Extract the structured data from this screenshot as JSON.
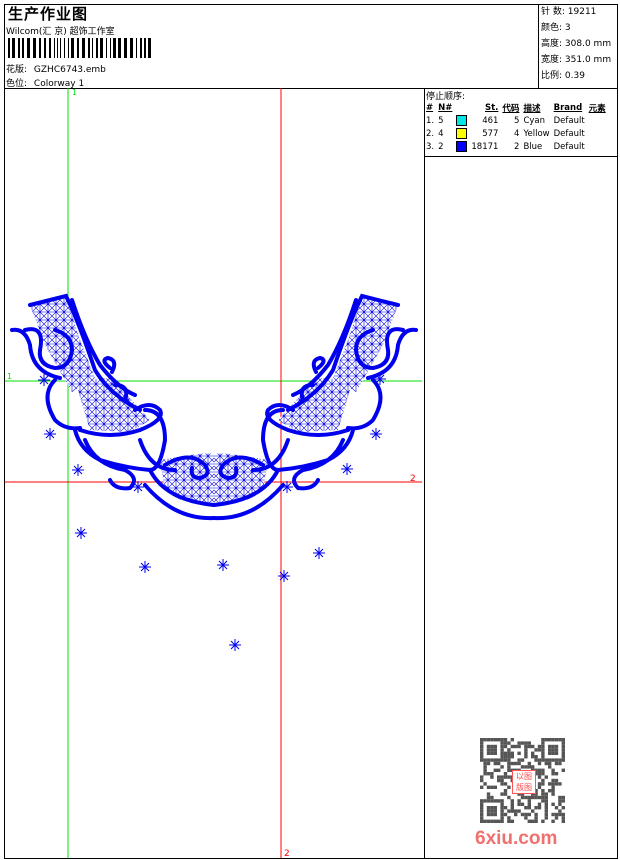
{
  "header": {
    "title": "生产作业图",
    "company": "Wilcom(汇 京) 超饰工作室",
    "design_label": "花版:",
    "design_value": "GZHC6743.emb",
    "colorway_label": "色位:",
    "colorway_value": "Colorway 1"
  },
  "info": [
    {
      "label": "针 数:",
      "value": "19211"
    },
    {
      "label": "颜色:",
      "value": "3"
    },
    {
      "label": "高度:",
      "value": "308.0 mm"
    },
    {
      "label": "宽度:",
      "value": "351.0 mm"
    },
    {
      "label": "比例:",
      "value": "0.39"
    }
  ],
  "stop_sequence": {
    "title": "停止顺序:",
    "columns": [
      "#",
      "N#",
      "St.",
      "代码",
      "描述",
      "Brand",
      "元素"
    ],
    "rows": [
      {
        "index": "1.",
        "n": "5",
        "color": "#00e5e5",
        "stitches": "461",
        "code": "5",
        "desc": "Cyan",
        "brand": "Default"
      },
      {
        "index": "2.",
        "n": "4",
        "color": "#ffff00",
        "stitches": "577",
        "code": "4",
        "desc": "Yellow",
        "brand": "Default"
      },
      {
        "index": "3.",
        "n": "2",
        "color": "#0000ff",
        "stitches": "18171",
        "code": "2",
        "desc": "Blue",
        "brand": "Default"
      }
    ]
  },
  "canvas": {
    "guide1_label": "1",
    "guide2_label": "2",
    "guide1_color": "#00e000",
    "guide2_color": "#ff0000",
    "design_color": "#0000ee"
  },
  "watermark": {
    "logo_text": "6xiu.com",
    "stamp_text": "以图版图"
  }
}
